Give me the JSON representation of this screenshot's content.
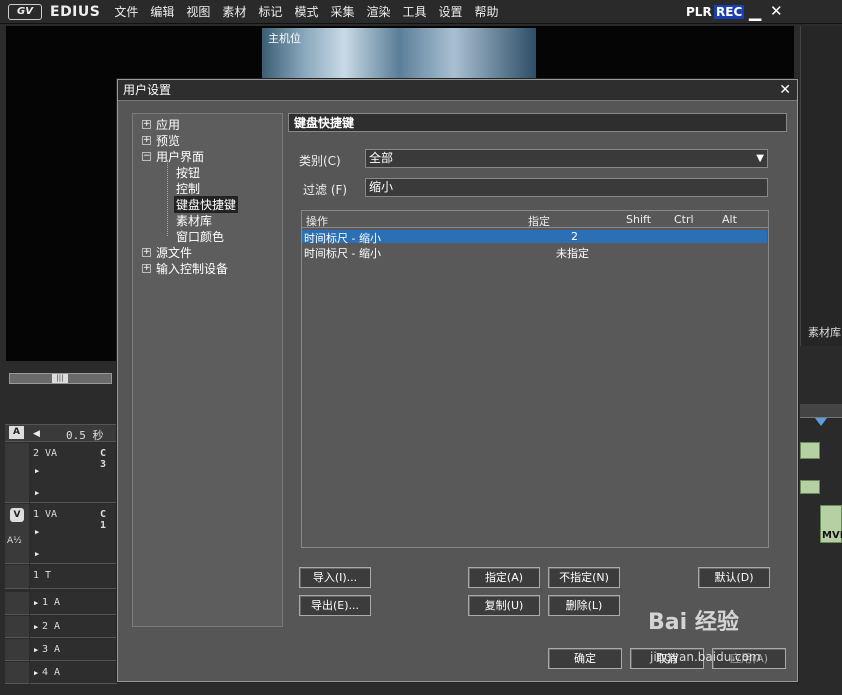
{
  "app": {
    "name": "EDIUS",
    "menu": [
      "文件",
      "编辑",
      "视图",
      "素材",
      "标记",
      "模式",
      "采集",
      "渲染",
      "工具",
      "设置",
      "帮助"
    ],
    "plr": "PLR",
    "rec": "REC"
  },
  "player": {
    "thumb_label": "主机位"
  },
  "right_panel": {
    "library_label": "素材库"
  },
  "timeline": {
    "zoom": "0.5 秒",
    "tracks": [
      {
        "name": "2 VA",
        "flag": "C 3"
      },
      {
        "name": "1 VA",
        "flag": "C 1"
      },
      {
        "name": "1 T",
        "flag": ""
      },
      {
        "name": "1 A",
        "flag": ""
      },
      {
        "name": "2 A",
        "flag": ""
      },
      {
        "name": "3 A",
        "flag": ""
      },
      {
        "name": "4 A",
        "flag": ""
      }
    ],
    "right_clip_label": "MVI"
  },
  "dialog": {
    "title": "用户设置",
    "tree": [
      {
        "label": "应用",
        "level": 0,
        "expander": "+"
      },
      {
        "label": "预览",
        "level": 0,
        "expander": "+"
      },
      {
        "label": "用户界面",
        "level": 0,
        "expander": "−"
      },
      {
        "label": "按钮",
        "level": 1
      },
      {
        "label": "控制",
        "level": 1
      },
      {
        "label": "键盘快捷键",
        "level": 1,
        "selected": true
      },
      {
        "label": "素材库",
        "level": 1
      },
      {
        "label": "窗口颜色",
        "level": 1
      },
      {
        "label": "源文件",
        "level": 0,
        "expander": "+"
      },
      {
        "label": "输入控制设备",
        "level": 0,
        "expander": "+"
      }
    ],
    "section_title": "键盘快捷键",
    "category_label": "类别(C)",
    "category_value": "全部",
    "filter_label": "过滤 (F)",
    "filter_value": "缩小",
    "list": {
      "headers": [
        "操作",
        "指定",
        "Shift",
        "Ctrl",
        "Alt"
      ],
      "rows": [
        {
          "action": "时间标尺 - 缩小",
          "assign": "2",
          "selected": true
        },
        {
          "action": "时间标尺 - 缩小",
          "assign": "未指定",
          "selected": false
        }
      ]
    },
    "buttons": {
      "import": "导入(I)...",
      "export": "导出(E)...",
      "assign": "指定(A)",
      "unassign": "不指定(N)",
      "default": "默认(D)",
      "copy": "复制(U)",
      "delete": "删除(L)",
      "ok": "确定",
      "cancel": "取消",
      "apply": "应用(A)"
    }
  },
  "watermark": {
    "logo": "Bai 经验",
    "url": "jingyan.baidu.com"
  },
  "colors": {
    "selection": "#2b6fb5",
    "rec_badge": "#1a3fb0",
    "dialog_bg": "#565656"
  }
}
